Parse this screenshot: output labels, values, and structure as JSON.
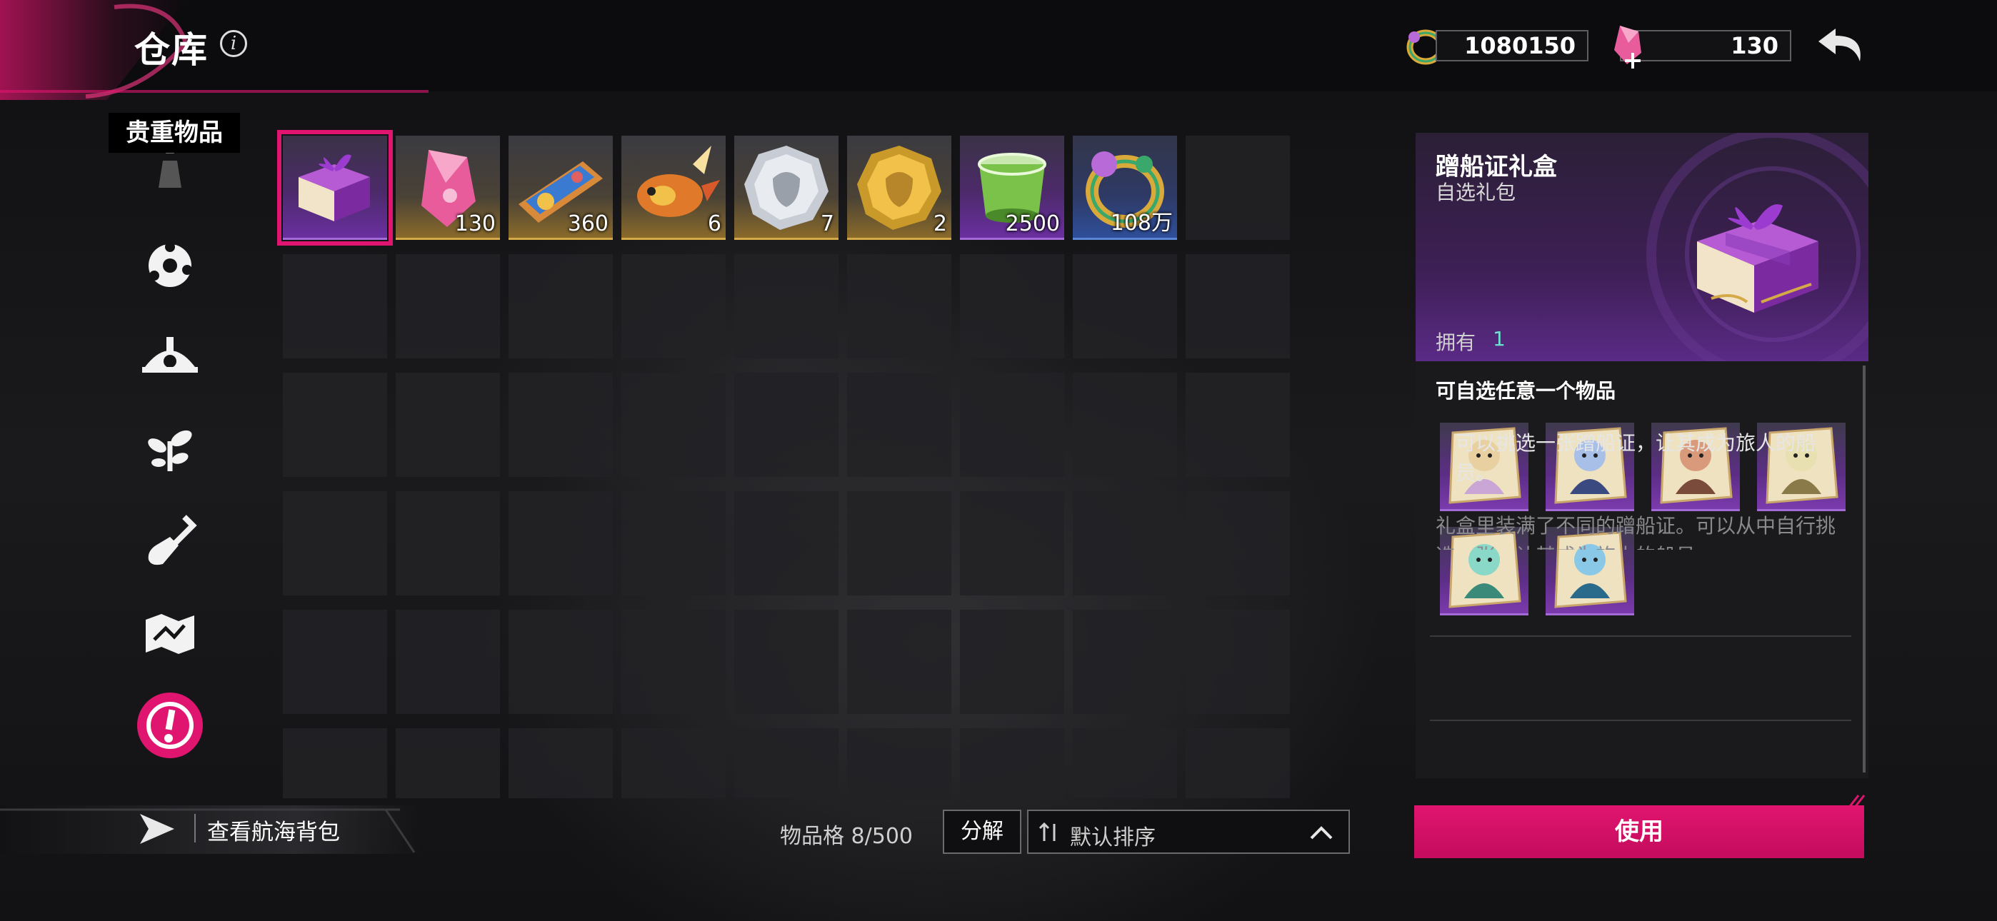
{
  "header": {
    "title": "仓库",
    "info_icon": "info-icon",
    "currency_gold_value": "1080150",
    "currency_gold_icon": "golden-ring-icon",
    "currency_gem_value": "130",
    "currency_gem_icon": "pink-crystal-plus-icon",
    "back_icon": "back-arrow-icon"
  },
  "sidebar": {
    "active_label": "贵重物品",
    "items": [
      {
        "icon": "valuables-icon"
      },
      {
        "icon": "gear-flower-icon"
      },
      {
        "icon": "ship-wheel-icon"
      },
      {
        "icon": "sprout-icon"
      },
      {
        "icon": "shovel-icon"
      },
      {
        "icon": "map-icon"
      },
      {
        "icon": "alert-icon",
        "active": true
      }
    ]
  },
  "inventory": {
    "items": [
      {
        "icon": "purple-gift-box-icon",
        "count": "",
        "selected": true,
        "rarity": "purple"
      },
      {
        "icon": "pink-crystal-icon",
        "count": "130",
        "rarity": "gold"
      },
      {
        "icon": "scroll-ticket-icon",
        "count": "360",
        "rarity": "gold"
      },
      {
        "icon": "koi-lantern-icon",
        "count": "6",
        "rarity": "gold"
      },
      {
        "icon": "silver-coin-icon",
        "count": "7",
        "rarity": "gold"
      },
      {
        "icon": "gold-coin-icon",
        "count": "2",
        "rarity": "gold"
      },
      {
        "icon": "green-jelly-cup-icon",
        "count": "2500",
        "rarity": "purple"
      },
      {
        "icon": "golden-ring-icon",
        "count": "108万",
        "rarity": "blue"
      }
    ],
    "capacity_text": "物品格 8/500",
    "decompose_label": "分解",
    "sort_label": "默认排序",
    "sort_icon": "sort-arrows-icon",
    "sort_chevron": "chevron-up-icon"
  },
  "detail": {
    "name": "蹭船证礼盒",
    "type": "自选礼包",
    "own_label": "拥有",
    "own_count": "1",
    "choose_title": "可自选任意一个物品",
    "choices": [
      {
        "icon": "boarding-pass-card-icon"
      },
      {
        "icon": "boarding-pass-card-icon"
      },
      {
        "icon": "boarding-pass-card-icon"
      },
      {
        "icon": "boarding-pass-card-icon"
      },
      {
        "icon": "boarding-pass-card-icon"
      },
      {
        "icon": "boarding-pass-card-icon"
      }
    ],
    "description": "可以挑选一张蹭船证，让其成为旅人的船员。",
    "lore": "礼盒里装满了不同的蹭船证。可以从中自行挑选一张，让其成为旅人的船员。",
    "use_label": "使用"
  },
  "footer": {
    "bag_link_label": "查看航海背包",
    "bag_link_icon": "arrow-right-icon"
  },
  "colors": {
    "accent": "#e0156f",
    "purple": "#6a2fa0",
    "gold": "#c9a045",
    "blue": "#2f4f9a",
    "own_count": "#6ee0d0"
  }
}
